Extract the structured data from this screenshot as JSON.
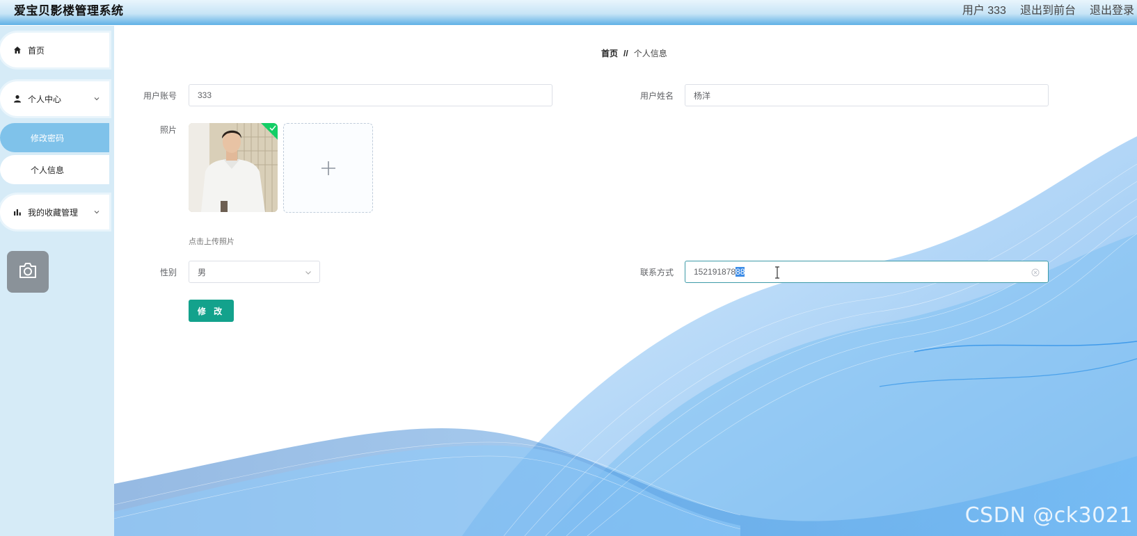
{
  "header": {
    "app_title": "爱宝贝影楼管理系统",
    "user_label": "用户 333",
    "exit_front": "退出到前台",
    "logout": "退出登录"
  },
  "sidebar": {
    "home": "首页",
    "personal_center": "个人中心",
    "change_password": "修改密码",
    "personal_info": "个人信息",
    "favorites_mgmt": "我的收藏管理"
  },
  "breadcrumb": {
    "home": "首页",
    "separator": "//",
    "current": "个人信息"
  },
  "form": {
    "account_label": "用户账号",
    "account_value": "333",
    "name_label": "用户姓名",
    "name_value": "杨洋",
    "photo_label": "照片",
    "upload_tip": "点击上传照片",
    "gender_label": "性别",
    "gender_value": "男",
    "contact_label": "联系方式",
    "contact_value_unselected": "152191878",
    "contact_value_selected": "88",
    "submit": "修 改"
  },
  "watermark": "CSDN @ck3021",
  "colors": {
    "header_gradient_bottom": "#5fb0e6",
    "sidebar_bg": "#d6ebf7",
    "active_menu": "#7fc2ea",
    "submit_btn": "#13a28c",
    "wave_blue": "#1e88e5"
  }
}
